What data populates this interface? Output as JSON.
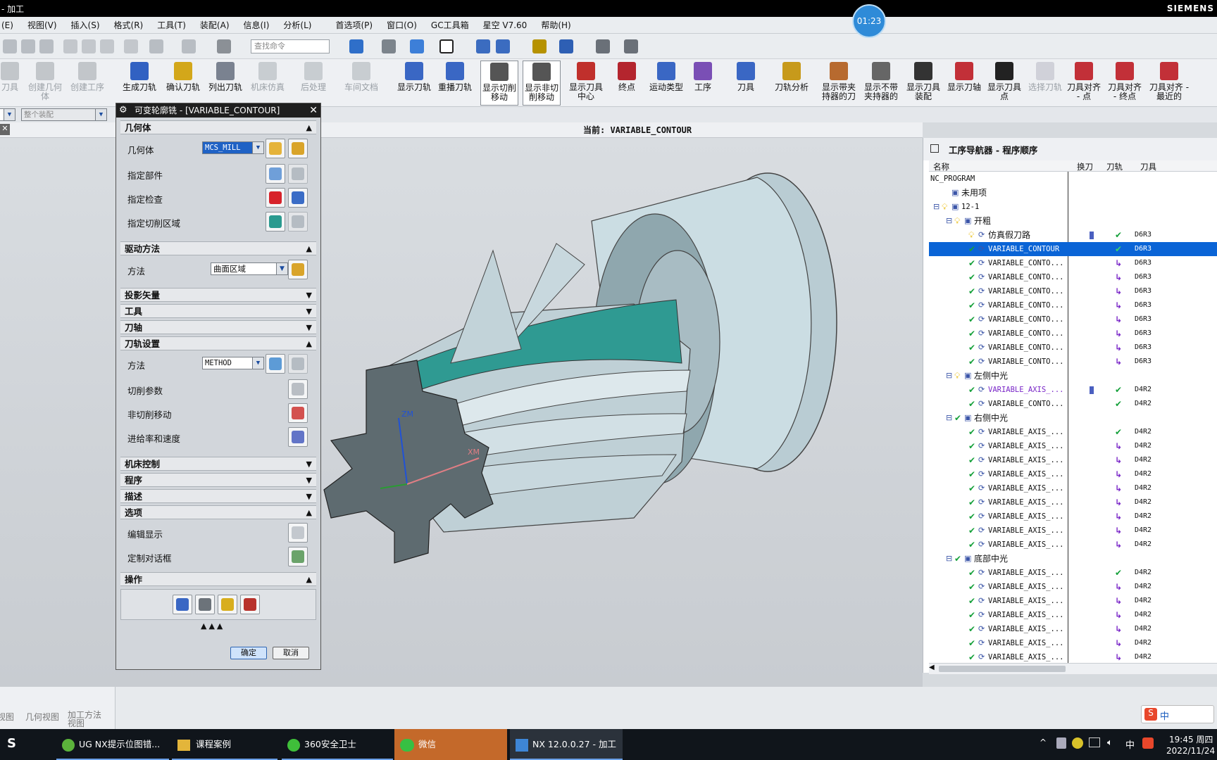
{
  "window": {
    "title": "- 加工",
    "brand": "SIEMENS",
    "timer": "01:23"
  },
  "menu": [
    "视图(V)",
    "插入(S)",
    "格式(R)",
    "工具(T)",
    "装配(A)",
    "信息(I)",
    "分析(L)",
    "首选项(P)",
    "窗口(O)",
    "GC工具箱",
    "星空 V7.60",
    "帮助(H)"
  ],
  "menu_first": "(E)",
  "search_placeholder": "查找命令",
  "toolbar": [
    {
      "label": "刀具",
      "dim": true
    },
    {
      "label": "创建几何体",
      "dim": true
    },
    {
      "label": "创建工序",
      "dim": true
    },
    {
      "label": "生成刀轨"
    },
    {
      "label": "确认刀轨"
    },
    {
      "label": "列出刀轨"
    },
    {
      "label": "机床仿真",
      "dim": true
    },
    {
      "label": "后处理",
      "dim": true
    },
    {
      "label": "车间文档",
      "dim": true
    },
    {
      "label": "显示刀轨"
    },
    {
      "label": "重播刀轨"
    },
    {
      "label": "显示切削移动",
      "sel": true
    },
    {
      "label": "显示非切削移动",
      "sel": true
    },
    {
      "label": "显示刀具中心"
    },
    {
      "label": "终点"
    },
    {
      "label": "运动类型"
    },
    {
      "label": "工序"
    },
    {
      "label": "刀具"
    },
    {
      "label": "刀轨分析"
    },
    {
      "label": "显示带夹持器的刀"
    },
    {
      "label": "显示不带夹持器的"
    },
    {
      "label": "显示刀具装配"
    },
    {
      "label": "显示刀轴"
    },
    {
      "label": "显示刀具点"
    },
    {
      "label": "选择刀轨",
      "dim": true
    },
    {
      "label": "刀具对齐 - 点"
    },
    {
      "label": "刀具对齐 - 终点"
    },
    {
      "label": "刀具对齐 - 最近的"
    }
  ],
  "assembly_filter": "整个装配",
  "current_label": "当前: VARIABLE_CONTOUR",
  "dialog": {
    "title": "可变轮廓铣 - [VARIABLE_CONTOUR]",
    "sections": {
      "geometry": "几何体",
      "drive": "驱动方法",
      "projection": "投影矢量",
      "tool": "工具",
      "axis": "刀轴",
      "path": "刀轨设置",
      "machine": "机床控制",
      "program": "程序",
      "desc": "描述",
      "options": "选项",
      "actions": "操作"
    },
    "rows": {
      "geometry": "几何体",
      "part": "指定部件",
      "check": "指定检查",
      "cut_area": "指定切削区域",
      "method": "方法",
      "path_method": "方法",
      "cut_params": "切削参数",
      "noncut": "非切削移动",
      "feeds": "进给率和速度",
      "edit_display": "编辑显示",
      "custom_dialog": "定制对话框"
    },
    "geometry_value": "MCS_MILL",
    "drive_value": "曲面区域",
    "method_value": "METHOD",
    "ok": "确定",
    "cancel": "取消"
  },
  "navigator": {
    "title": "工序导航器 - 程序顺序",
    "columns": [
      "名称",
      "换刀",
      "刀轨",
      "刀具"
    ],
    "rows": [
      {
        "name": "NC_PROGRAM",
        "level": 0,
        "kind": "root"
      },
      {
        "name": "未用项",
        "level": 1,
        "kind": "folder"
      },
      {
        "name": "12-1",
        "level": 1,
        "kind": "group",
        "mark": "bulb"
      },
      {
        "name": "开粗",
        "level": 2,
        "kind": "group",
        "mark": "bulb"
      },
      {
        "name": "仿真假刀路",
        "level": 3,
        "kind": "op",
        "mark": "bulb",
        "tc": true,
        "path": "check",
        "tool": "D6R3"
      },
      {
        "name": "VARIABLE_CONTOUR",
        "level": 3,
        "kind": "op",
        "mark": "check",
        "path": "check",
        "tool": "D6R3",
        "sel": true
      },
      {
        "name": "VARIABLE_CONTO...",
        "level": 3,
        "kind": "op",
        "mark": "check",
        "path": "arrow",
        "tool": "D6R3"
      },
      {
        "name": "VARIABLE_CONTO...",
        "level": 3,
        "kind": "op",
        "mark": "check",
        "path": "arrow",
        "tool": "D6R3"
      },
      {
        "name": "VARIABLE_CONTO...",
        "level": 3,
        "kind": "op",
        "mark": "check",
        "path": "arrow",
        "tool": "D6R3"
      },
      {
        "name": "VARIABLE_CONTO...",
        "level": 3,
        "kind": "op",
        "mark": "check",
        "path": "arrow",
        "tool": "D6R3"
      },
      {
        "name": "VARIABLE_CONTO...",
        "level": 3,
        "kind": "op",
        "mark": "check",
        "path": "arrow",
        "tool": "D6R3"
      },
      {
        "name": "VARIABLE_CONTO...",
        "level": 3,
        "kind": "op",
        "mark": "check",
        "path": "arrow",
        "tool": "D6R3"
      },
      {
        "name": "VARIABLE_CONTO...",
        "level": 3,
        "kind": "op",
        "mark": "check",
        "path": "arrow",
        "tool": "D6R3"
      },
      {
        "name": "VARIABLE_CONTO...",
        "level": 3,
        "kind": "op",
        "mark": "check",
        "path": "arrow",
        "tool": "D6R3"
      },
      {
        "name": "左侧中光",
        "level": 2,
        "kind": "group",
        "mark": "bulb"
      },
      {
        "name": "VARIABLE_AXIS_...",
        "level": 3,
        "kind": "op",
        "mark": "check",
        "tc": true,
        "path": "check",
        "tool": "D4R2",
        "purple": true
      },
      {
        "name": "VARIABLE_CONTO...",
        "level": 3,
        "kind": "op",
        "mark": "check",
        "path": "check",
        "tool": "D4R2"
      },
      {
        "name": "右侧中光",
        "level": 2,
        "kind": "group",
        "mark": "check"
      },
      {
        "name": "VARIABLE_AXIS_...",
        "level": 3,
        "kind": "op",
        "mark": "check",
        "path": "check",
        "tool": "D4R2"
      },
      {
        "name": "VARIABLE_AXIS_...",
        "level": 3,
        "kind": "op",
        "mark": "check",
        "path": "arrow",
        "tool": "D4R2"
      },
      {
        "name": "VARIABLE_AXIS_...",
        "level": 3,
        "kind": "op",
        "mark": "check",
        "path": "arrow",
        "tool": "D4R2"
      },
      {
        "name": "VARIABLE_AXIS_...",
        "level": 3,
        "kind": "op",
        "mark": "check",
        "path": "arrow",
        "tool": "D4R2"
      },
      {
        "name": "VARIABLE_AXIS_...",
        "level": 3,
        "kind": "op",
        "mark": "check",
        "path": "arrow",
        "tool": "D4R2"
      },
      {
        "name": "VARIABLE_AXIS_...",
        "level": 3,
        "kind": "op",
        "mark": "check",
        "path": "arrow",
        "tool": "D4R2"
      },
      {
        "name": "VARIABLE_AXIS_...",
        "level": 3,
        "kind": "op",
        "mark": "check",
        "path": "arrow",
        "tool": "D4R2"
      },
      {
        "name": "VARIABLE_AXIS_...",
        "level": 3,
        "kind": "op",
        "mark": "check",
        "path": "arrow",
        "tool": "D4R2"
      },
      {
        "name": "VARIABLE_AXIS_...",
        "level": 3,
        "kind": "op",
        "mark": "check",
        "path": "arrow",
        "tool": "D4R2"
      },
      {
        "name": "底部中光",
        "level": 2,
        "kind": "group",
        "mark": "check"
      },
      {
        "name": "VARIABLE_AXIS_...",
        "level": 3,
        "kind": "op",
        "mark": "check",
        "path": "check",
        "tool": "D4R2"
      },
      {
        "name": "VARIABLE_AXIS_...",
        "level": 3,
        "kind": "op",
        "mark": "check",
        "path": "arrow",
        "tool": "D4R2"
      },
      {
        "name": "VARIABLE_AXIS_...",
        "level": 3,
        "kind": "op",
        "mark": "check",
        "path": "arrow",
        "tool": "D4R2"
      },
      {
        "name": "VARIABLE_AXIS_...",
        "level": 3,
        "kind": "op",
        "mark": "check",
        "path": "arrow",
        "tool": "D4R2"
      },
      {
        "name": "VARIABLE_AXIS_...",
        "level": 3,
        "kind": "op",
        "mark": "check",
        "path": "arrow",
        "tool": "D4R2"
      },
      {
        "name": "VARIABLE_AXIS_...",
        "level": 3,
        "kind": "op",
        "mark": "check",
        "path": "arrow",
        "tool": "D4R2"
      },
      {
        "name": "VARIABLE_AXIS_...",
        "level": 3,
        "kind": "op",
        "mark": "check",
        "path": "arrow",
        "tool": "D4R2"
      }
    ]
  },
  "bottom_tabs": [
    "视图",
    "几何视图",
    "加工方法视图"
  ],
  "axes": {
    "z": "ZM",
    "x": "XM"
  },
  "taskbar": {
    "items": [
      "UG NX提示位图错...",
      "课程案例",
      "360安全卫士",
      "微信",
      "NX 12.0.0.27 - 加工"
    ],
    "ime": "中",
    "time": "19:45 周四",
    "date": "2022/11/24"
  },
  "colors": {
    "accent": "#0a64d6",
    "teal": "#1f8f86",
    "check": "#15a03a",
    "arrow": "#7a27c8"
  }
}
